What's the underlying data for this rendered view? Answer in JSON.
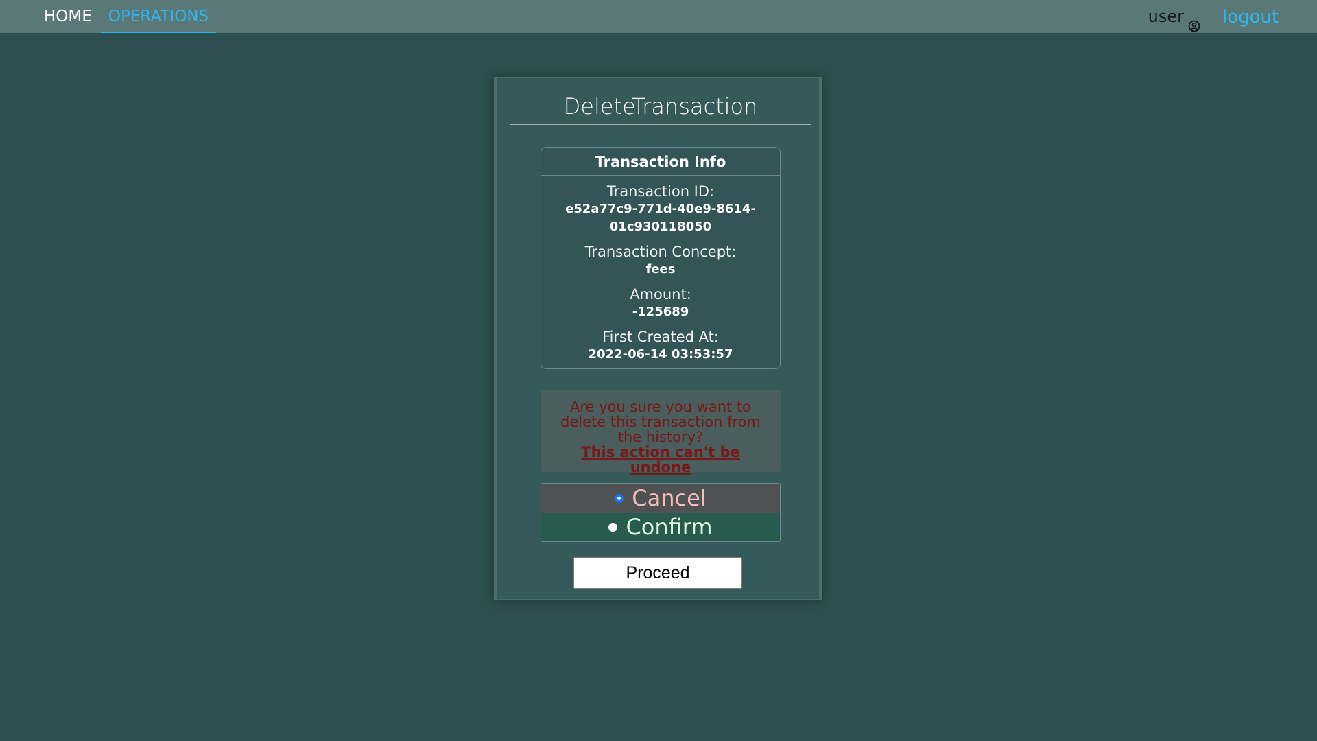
{
  "nav": {
    "home_label": "HOME",
    "operations_label": "OPERATIONS",
    "active_tab": "OPERATIONS",
    "user_label": "user",
    "user_icon": "user-circle-icon",
    "logout_label": "logout"
  },
  "card": {
    "title": "DeleteTransaction",
    "info": {
      "header": "Transaction Info",
      "id_label": "Transaction ID:",
      "id_value_line1": "e52a77c9-771d-40e9-8614-",
      "id_value_line2": "01c930118050",
      "concept_label": "Transaction Concept:",
      "concept_value": "fees",
      "amount_label": "Amount:",
      "amount_value": "-125689",
      "created_label": "First Created At:",
      "created_value": "2022-06-14 03:53:57"
    },
    "warning": {
      "text": "Are you sure you want to delete this transaction from the history?",
      "emphasis": "This action can't be undone"
    },
    "options": {
      "cancel_label": "Cancel",
      "confirm_label": "Confirm",
      "selected": "Cancel"
    },
    "proceed_label": "Proceed"
  },
  "colors": {
    "background": "#2e4f4f",
    "navbar": "#5b7878",
    "accent": "#2fb6ef",
    "warning_text": "#7a1717",
    "cancel_bg": "#4f5152",
    "confirm_bg": "#285a4d"
  }
}
